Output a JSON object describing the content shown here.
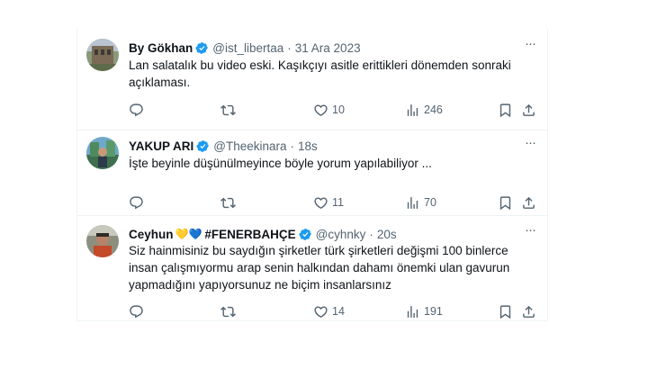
{
  "colors": {
    "verified": "#1d9bf0",
    "muted": "#536471",
    "text": "#0f1419",
    "border": "#eff3f4"
  },
  "tweets": [
    {
      "name": "By Gökhan",
      "verified": true,
      "handle": "@ist_libertaa",
      "separator": "·",
      "date": "31 Ara 2023",
      "text": "Lan salatalık bu video eski. Kaşıkçıyı asitle erittikleri dönemden sonraki açıklaması.",
      "replies": "",
      "retweets": "",
      "likes": "10",
      "views": "246"
    },
    {
      "name": "YAKUP ARI",
      "verified": true,
      "handle": "@Theekinara",
      "separator": "·",
      "date": "18s",
      "text": "İşte beyinle düşünülmeyince böyle yorum yapılabiliyor ...",
      "replies": "",
      "retweets": "",
      "likes": "11",
      "views": "70"
    },
    {
      "name": "Ceyhun",
      "name_suffix": "#FENERBAHÇE",
      "hearts": "💛💙",
      "verified": true,
      "handle": "@cyhnky",
      "separator": "·",
      "date": "20s",
      "text": "Siz hainmisiniz bu saydığın şirketler türk şirketleri değişmi 100 binlerce insan çalışmıyormu arap senin halkından dahamı önemki ulan gavurun yapmadığını yapıyorsunuz ne biçim insanlarsınız",
      "replies": "",
      "retweets": "",
      "likes": "14",
      "views": "191"
    }
  ],
  "icons": {
    "reply": "reply-icon",
    "retweet": "retweet-icon",
    "like": "heart-icon",
    "views": "views-icon",
    "bookmark": "bookmark-icon",
    "share": "share-icon",
    "more": "more-icon",
    "verified": "verified-badge-icon"
  },
  "more_glyph": "···"
}
